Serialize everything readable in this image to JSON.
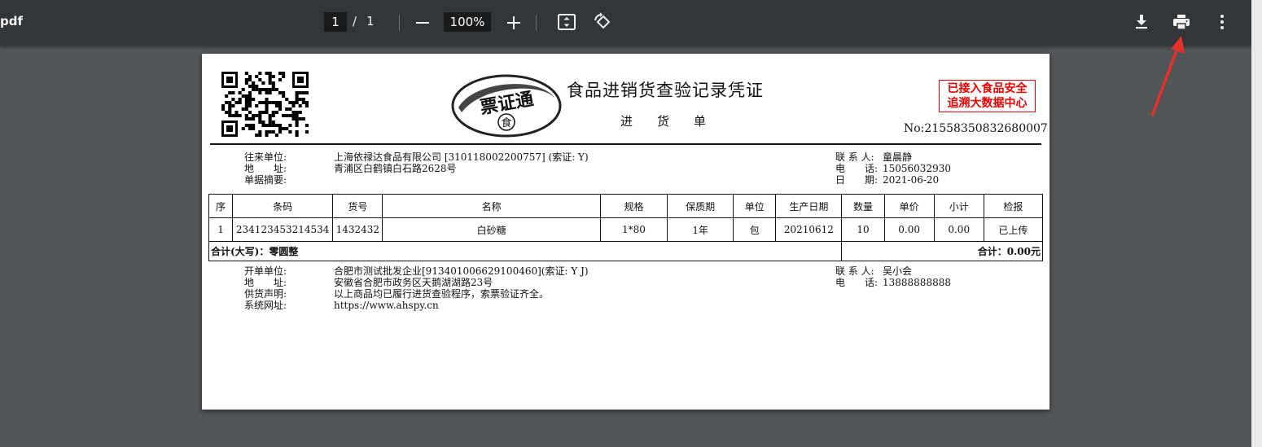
{
  "toolbar": {
    "doc_title": "pdf",
    "current_page": "1",
    "page_separator": "/",
    "total_pages": "1",
    "zoom": "100%",
    "icons": [
      "minus-icon",
      "plus-icon",
      "fit-page-icon",
      "rotate-icon",
      "download-icon",
      "print-icon",
      "more-vert-icon"
    ]
  },
  "document": {
    "title": "食品进销货查验记录凭证",
    "subtitle": "进　　货　　单",
    "logo_text": "票证通",
    "logo_char": "食",
    "stamp_line1": "已接入食品安全",
    "stamp_line2": "追溯大数据中心",
    "number": "No:21558350832680007",
    "partner": {
      "unit_label": "往来单位:",
      "unit_value": "上海依禄达食品有限公司 [310118002200757] (索证: Y)",
      "address_label": "地　　址:",
      "address_value": "青浦区白鹤镇白石路2628号",
      "summary_label": "单据摘要:",
      "summary_value": "",
      "contact_label": "联 系 人:",
      "contact_value": "童晨静",
      "phone_label": "电　　话:",
      "phone_value": "15056032930",
      "date_label": "日　　期:",
      "date_value": "2021-06-20"
    },
    "table": {
      "headers": [
        "序",
        "条码",
        "货号",
        "名称",
        "规格",
        "保质期",
        "单位",
        "生产日期",
        "数量",
        "单价",
        "小计",
        "检报"
      ],
      "rows": [
        [
          "1",
          "234123453214534",
          "1432432",
          "白砂糖",
          "1*80",
          "1年",
          "包",
          "20210612",
          "10",
          "0.00",
          "0.00",
          "已上传"
        ]
      ],
      "total_words": "合计(大写)：零圆整",
      "total_amount": "合计：0.00元"
    },
    "issuer": {
      "unit_label": "开单单位:",
      "unit_value": "合肥市测试批发企业[913401006629100460](索证: Y J)",
      "address_label": "地　　址:",
      "address_value": "安徽省合肥市政务区天鹅湖湖路23号",
      "statement_label": "供货声明:",
      "statement_value": "以上商品均已履行进货查验程序，索票验证齐全。",
      "website_label": "系统网址:",
      "website_value": "https://www.ahspy.cn",
      "contact_label": "联 系 人:",
      "contact_value": "吴小会",
      "phone_label": "电　　话:",
      "phone_value": "13888888888"
    }
  },
  "colors": {
    "toolbar_bg": "#323639",
    "viewer_bg": "#525659",
    "stamp_red": "#e00000",
    "annotation_red": "#e8302a"
  }
}
